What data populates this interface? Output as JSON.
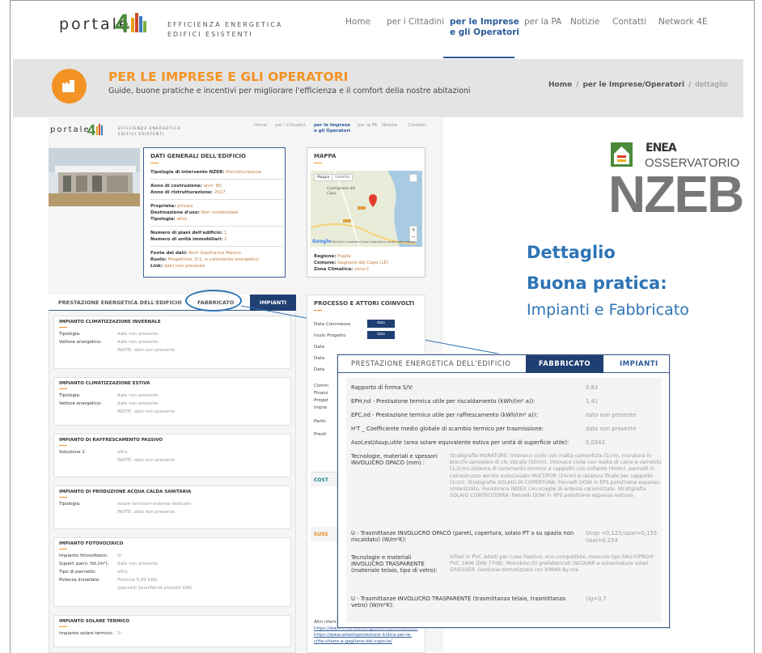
{
  "header": {
    "logo_text": "portale",
    "logo_tag1": "EFFICIENZA ENERGETICA",
    "logo_tag2": "EDIFICI ESISTENTI",
    "nav": [
      "Home",
      "per i Cittadini",
      "per le Imprese",
      "e gli Operatori",
      "per la PA",
      "Notizie",
      "Contatti",
      "Network 4E"
    ]
  },
  "banner": {
    "title": "PER LE IMPRESE E GLI OPERATORI",
    "subtitle": "Guide, buone pratiche e incentivi per migliorare l'efficienza e il comfort della nostre abitazioni",
    "crumb_home": "Home",
    "crumb_sep": "/",
    "crumb_section": "per le Imprese/Operatori",
    "crumb_current": "dettaglio"
  },
  "mini_nav": [
    "Home",
    "per i Cittadini",
    "per le Imprese",
    "e gli Operatori",
    "per la PA",
    "Notizie",
    "Contatti"
  ],
  "dati": {
    "title": "DATI GENERALI DELL'EDIFICIO",
    "rows": [
      [
        "Tipologia di intervento NZEB:",
        "Ristrutturazione"
      ],
      [
        "Anno di costruzione:",
        "anni '80"
      ],
      [
        "Anno di ristrutturazione:",
        "2017"
      ],
      [
        "Proprieta:",
        "privata"
      ],
      [
        "Destinazione d'uso:",
        "Non residenziale"
      ],
      [
        "Tipologia:",
        "altro"
      ],
      [
        "Numero di piani dell'edificio:",
        "1"
      ],
      [
        "Numero di unità immobiliari:",
        "1"
      ],
      [
        "Fonte dei dati:",
        "Arch Gianfranco Marino"
      ],
      [
        "Ruolo:",
        "Progettista, D.L. e consulente energetico"
      ],
      [
        "Link:",
        "dato non presente"
      ]
    ]
  },
  "mappa": {
    "title": "MAPPA",
    "map_btn": "Mappa",
    "sat_btn": "Satellite",
    "place": "Castrignano del Capo",
    "google": "Google",
    "terms": "Termini e condizioni d'uso  Segnala un errore nella mappa",
    "regione_l": "Regione:",
    "regione_v": "Puglia",
    "comune_l": "Comune:",
    "comune_v": "Gagliano del Capo (LE)",
    "zona_l": "Zona Climatica:",
    "zona_v": "zona C"
  },
  "side_brand": {
    "enea": "ENEA",
    "osservatorio": "OSSERVATORIO",
    "nzeb": "NZEB"
  },
  "callout": {
    "line1": "Dettaglio",
    "line2": "Buona pratica:",
    "line3": "Impianti e Fabbricato"
  },
  "left_tabs": {
    "prest": "PRESTAZIONE ENERGETICA DELL'EDIFICIO",
    "fabb": "FABBRICATO",
    "imp": "IMPIANTI"
  },
  "impianti": [
    {
      "title": "IMPIANTO CLIMATIZZAZIONE INVERNALE",
      "rows": [
        [
          "Tipologia:",
          "dato non presente"
        ],
        [
          "Vettore energetico:",
          "dato non presente"
        ],
        [
          "",
          "INOTE: dato non presente"
        ]
      ]
    },
    {
      "title": "IMPIANTO CLIMATIZZAZIONE ESTIVA",
      "rows": [
        [
          "Tipologia:",
          "dato non presente"
        ],
        [
          "Vettore energetico:",
          "dato non presente"
        ],
        [
          "",
          "INOTE: dato non presente"
        ]
      ]
    },
    {
      "title": "IMPIANTO DI RAFFRESCAMENTO PASSIVO",
      "rows": [
        [
          "Soluzione 1:",
          "altro"
        ],
        [
          "",
          "INOTE: dato non presente"
        ]
      ]
    },
    {
      "title": "IMPIANTO DI PRODUZIONE ACQUA CALDA SANITARIA",
      "rows": [
        [
          "Tipologia:",
          "solare termico+sistema dedicato"
        ],
        [
          "",
          "INOTE: dato non presente"
        ]
      ]
    },
    {
      "title": "IMPIANTO FOTOVOLTAICO",
      "rows": [
        [
          "Impianto fotovoltaico:",
          "Si"
        ],
        [
          "Superf. pann. fot.(m²):",
          "dato non presente"
        ],
        [
          "Tipo di pannello:",
          "altro"
        ],
        [
          "Potenza installata:",
          "Potenza 5,99 kWp"
        ],
        [
          "",
          "(pannelli SolarWorld prodotti GW)"
        ]
      ]
    },
    {
      "title": "IMPIANTO SOLARE TERMICO",
      "rows": [
        [
          "Impianto solare termico:",
          "Si"
        ]
      ]
    }
  ],
  "processo": {
    "title": "PROCESSO E ATTORI COINVOLTI",
    "rows": [
      "Data Commessa",
      "Inizio Progetto",
      "Data",
      "Data",
      "Data"
    ],
    "cell1": "dato",
    "cell2": "dato",
    "side": [
      "Comm",
      "Finanz",
      "Proget",
      "Impre",
      "Partic",
      "Presti"
    ],
    "cost": "COST",
    "suss": "SUSS",
    "refs_title": "Altri riferimenti:",
    "refs": [
      "https://www.smartbuildingitalia.it/premio2017/",
      "https://www.arbeitsprotezione.it/dica-per-le-",
      "citta-chiaro-a-gagliano-del-capo-le/"
    ]
  },
  "panel": {
    "tab_prest": "PRESTAZIONE ENERGETICA DELL'EDIFICIO",
    "tab_fabb": "FABBRICATO",
    "tab_imp": "IMPIANTI",
    "rows": [
      {
        "label": "Rapporto di forma S/V:",
        "value": "0,83"
      },
      {
        "label": "EPH,nd - Prestazione termica utile per riscaldamento (kWh/(m² a)):",
        "value": "1,41"
      },
      {
        "label": "EPC,nd - Prestazione termica utile per raffrescamento (kWh/(m² a)):",
        "value": "dato non presente"
      },
      {
        "label": "H'T _ Coefficiente medio globale di scambio termico per trasmissione:",
        "value": "dato non presente"
      },
      {
        "label": "Asol,est/Asup,utile (area solare equivalente estiva per unità di superficie utile):",
        "value": "0,0343"
      }
    ],
    "tec_opaco_label": "Tecnologie, materiali e spessori INVOLUCRO OPACO (mm) :",
    "tec_opaco_text": "Stratigrafia MURATURE: Intonaco civile con malta cementizia (1cm), muratura in blocchi semipieni di cls vibrato (30cm), intonaco civile con malta di calce e cemento (1,5cm),sistema di isolamento termico a cappotto con collante (4mm), pannelli in calcestruzzo aerato autoclavato MULTIPOR (24cm) e rasatura finale per cappotto (1cm). Stratigrafia SOLAIO DI COPERTURA: Pannelli DOW in EPS polistirene espanso sinterizzato, membrana INDEX con scaglie di ardesia ceramizzate. Stratigrafia SOLAIO CONTROTERRA: Pannelli DOW in XPS polistirene espanso estruso.",
    "u_opaco_label": "U - Trasmittanze INVOLUCRO OPACO (pareti, copertura, solaio PT o su spazio non riscaldato) (W/m²K):",
    "u_opaco_value1": "Ucop =0,123;Upar=0,155",
    "u_opaco_value2": "Usol=0,154",
    "tec_trasp_label": "Tecnologie e materiali INVOLUCRO TRASPARENTE (materiale telaio, tipo di vetro):",
    "tec_trasp_text": "Infissi in PVC adatti per Case Passive, eco-compatibile, mescola tipo RAU-FIPRO® PVC 1406 (DIN 7748). Monoblocchi prefabbricati INCOVAR e schermature solari GRIESSER. Gestione domotizzata con VIMAR By-me",
    "u_trasp_label": "U - Trasmittanze INVOLUCRO TRASPARENTE (trasmittanza telaio, trasmittanza vetro) (W/m²K):",
    "u_trasp_value": "Ug=0,7"
  }
}
